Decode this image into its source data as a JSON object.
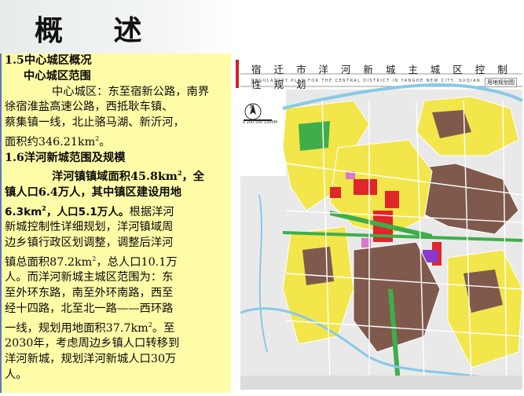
{
  "slide": {
    "title": "概  述"
  },
  "text": {
    "l1": "1.5中心城区概况",
    "l2": "中心城区范围",
    "l3": "中心城区：东至宿新公路，南界",
    "l4": "徐宿淮盐高速公路，西抵耿车镇、",
    "l5": "蔡集镇一线，北止骆马湖、新沂河，",
    "l6a": "面积约346.21km",
    "l6sup": "2",
    "l6b": "。",
    "l7": "1.6洋河新城范围及规模",
    "l8a": "洋河镇镇域面积45.8km",
    "l8sup": "2",
    "l8b": "，全",
    "l9": "镇人口6.4万人，其中镇区建设用地",
    "l10a": "6.3km",
    "l10sup": "2",
    "l10b": "，人口5.1万人。",
    "l10c": "根据洋河",
    "l11": "新城控制性详细规划，洋河镇域周",
    "l12": "边乡镇行政区划调整，调整后洋河",
    "l13a": "镇总面积87.2km",
    "l13sup": "2",
    "l13b": "，总人口10.1万",
    "l14": "人。而洋河新城主城区范围为：东",
    "l15": "至外环东路，南至外环南路，西至",
    "l16": "经十四路，北至北一路——西环路",
    "l17a": "一线，规划用地面积37.7km",
    "l17sup": "2",
    "l17b": "。至",
    "l18": "2030年，考虑周边乡镇人口转移到",
    "l19": "洋河新城，规划洋河新城人口30万",
    "l20": "人。"
  },
  "map": {
    "title": "宿 迁 市 洋 河 新 城 主 城 区 控 制 性 规 划",
    "subtitle": "REGULATORY PLAN FOR THE CENTRAL DISTRICT IN YANGHE NEW CITY, SUQIAN",
    "legend_label": "用地规划图",
    "north_label": "N",
    "scale_label": "0  200 500  1000M",
    "colors": {
      "residential": "#f2e64a",
      "commercial": "#e0252b",
      "industrial": "#7f5a4c",
      "green": "#3fae4a",
      "water": "#88c9e8",
      "public": "#d978c8",
      "purple": "#8a3ac8",
      "road": "#ffffff",
      "background": "#e9e9e9"
    }
  }
}
